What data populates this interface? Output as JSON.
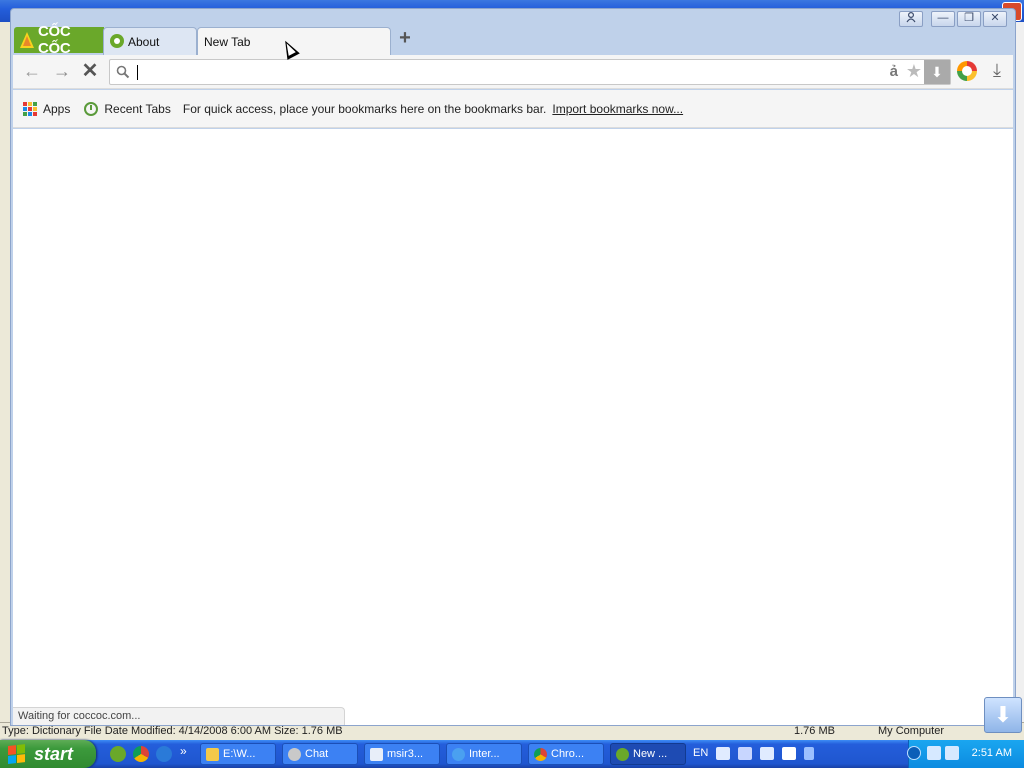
{
  "background_window": {
    "status_left": "Type: Dictionary File Date Modified: 4/14/2008 6:00 AM Size: 1.76 MB",
    "status_size": "1.76 MB",
    "status_location": "My Computer"
  },
  "browser": {
    "logo_text": "CỐC CỐC",
    "tabs": [
      {
        "label": "About"
      },
      {
        "label": "New Tab"
      }
    ],
    "window_controls": {
      "minimize": "—",
      "restore": "❐",
      "close": "✕"
    },
    "toolbar": {
      "omnibox_value": "",
      "translate_glyph": "ả"
    },
    "bookmarks_bar": {
      "apps_label": "Apps",
      "recent_tabs_label": "Recent Tabs",
      "message": "For quick access, place your bookmarks here on the bookmarks bar.",
      "import_link": "Import bookmarks now..."
    },
    "status_bubble": "Waiting for coccoc.com..."
  },
  "taskbar": {
    "start_label": "start",
    "tasks": [
      {
        "label": "E:\\W..."
      },
      {
        "label": "Chat"
      },
      {
        "label": "msir3..."
      },
      {
        "label": "Inter..."
      },
      {
        "label": "Chro..."
      },
      {
        "label": "New ..."
      }
    ],
    "language": "EN",
    "clock": "2:51 AM"
  }
}
